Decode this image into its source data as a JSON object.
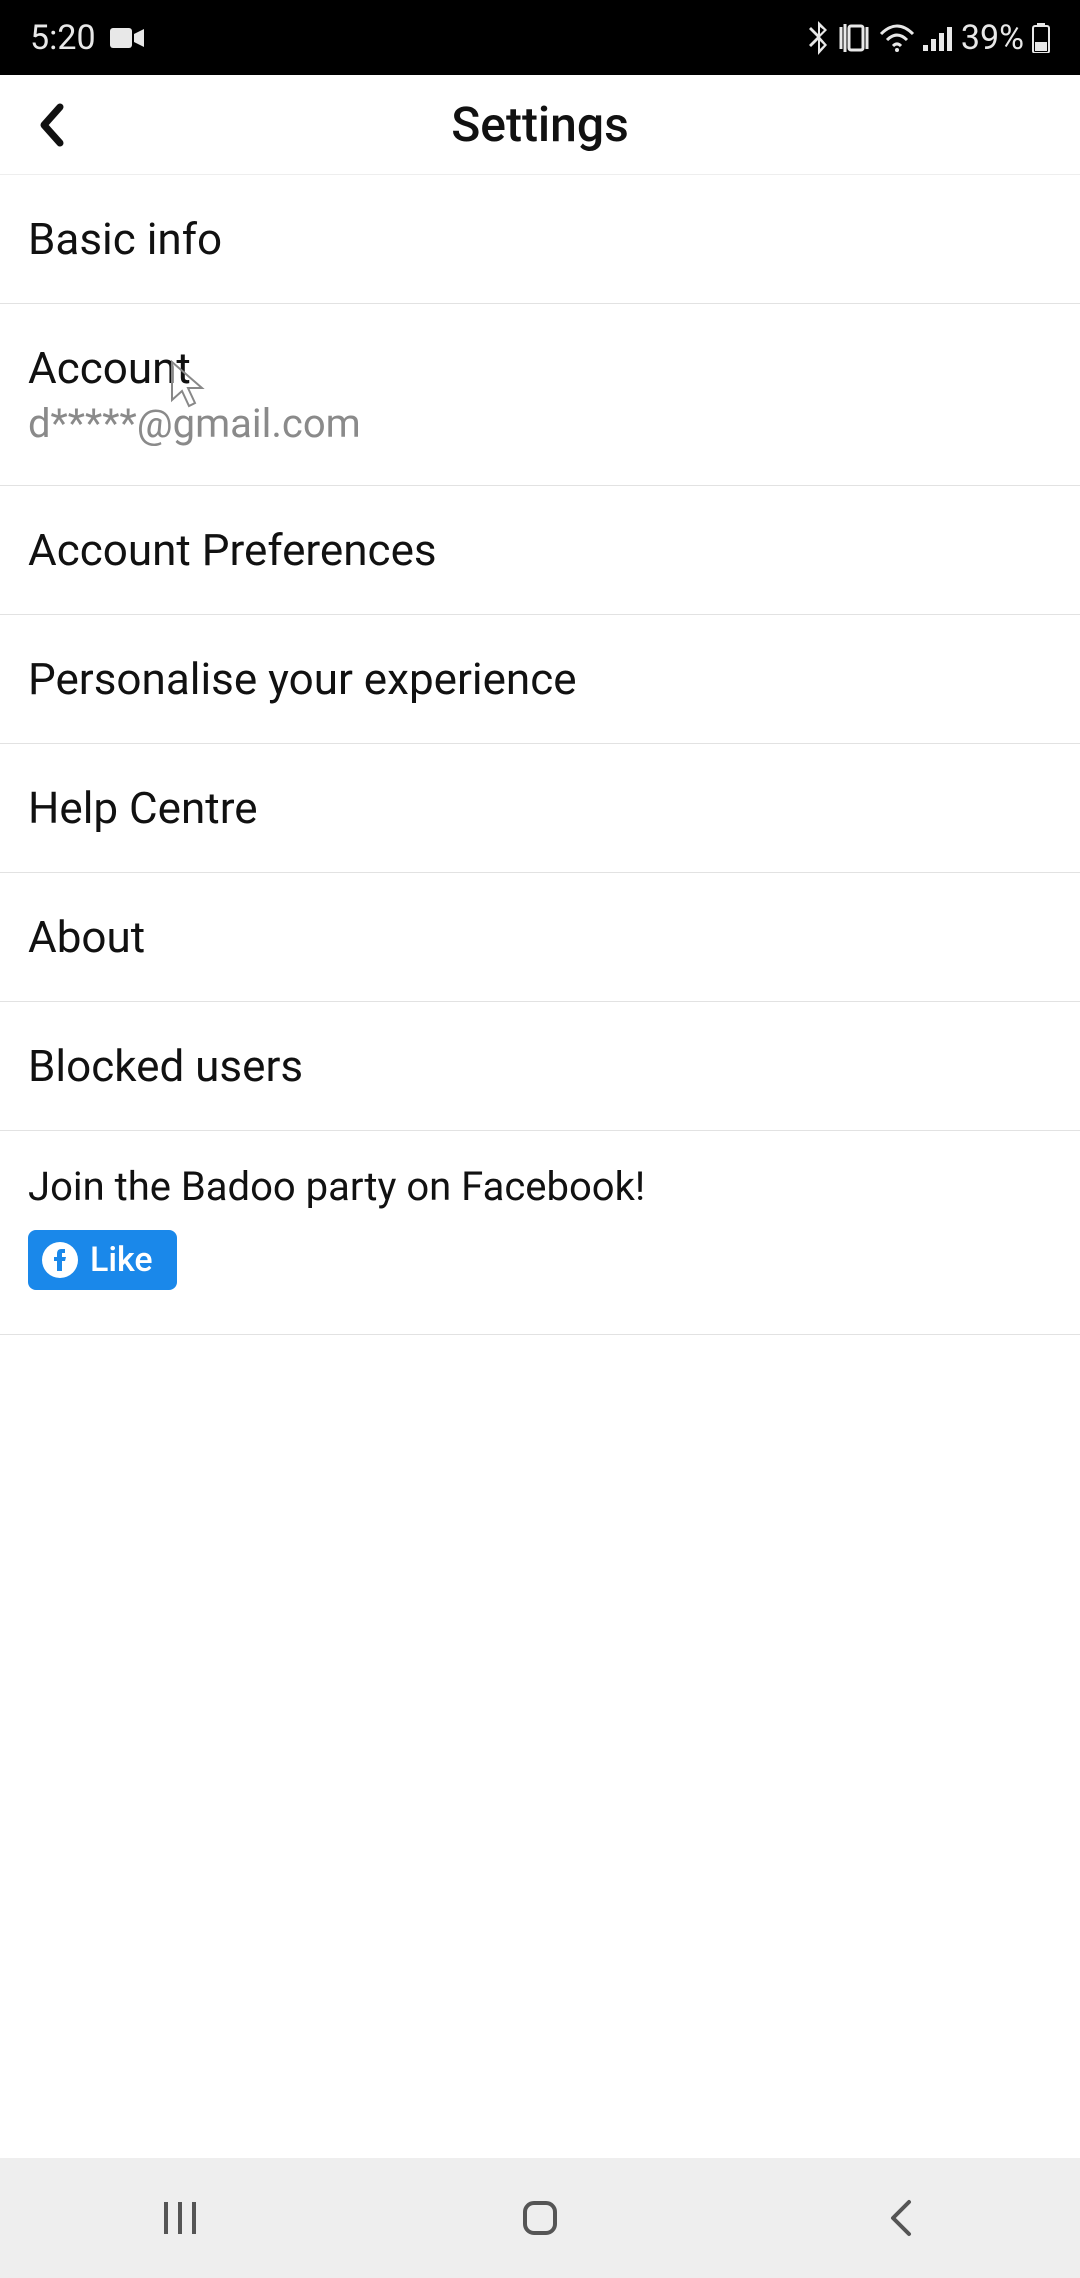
{
  "status": {
    "time": "5:20",
    "battery_text": "39%"
  },
  "header": {
    "title": "Settings"
  },
  "items": {
    "basic_info": {
      "title": "Basic info"
    },
    "account": {
      "title": "Account",
      "sub": "d*****@gmail.com"
    },
    "account_prefs": {
      "title": "Account Preferences"
    },
    "personalise": {
      "title": "Personalise your experience"
    },
    "help": {
      "title": "Help Centre"
    },
    "about": {
      "title": "About"
    },
    "blocked": {
      "title": "Blocked users"
    }
  },
  "facebook": {
    "title": "Join the Badoo party on Facebook!",
    "like_label": "Like"
  }
}
